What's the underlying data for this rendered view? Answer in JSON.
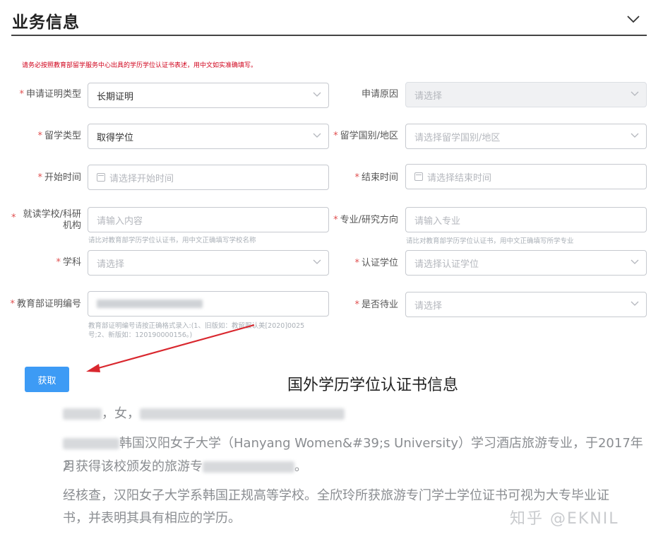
{
  "header": {
    "title": "业务信息"
  },
  "notice": "请务必按照教育部留学服务中心出具的学历学位认证书表述，用中文如实准确填写。",
  "fields": {
    "cert_type": {
      "label": "申请证明类型",
      "value": "长期证明"
    },
    "apply_reason": {
      "label": "申请原因",
      "placeholder": "请选择"
    },
    "study_type": {
      "label": "留学类型",
      "value": "取得学位"
    },
    "study_country": {
      "label": "留学国别/地区",
      "placeholder": "请选择留学国别/地区"
    },
    "start_time": {
      "label": "开始时间",
      "placeholder": "请选择开始时间"
    },
    "end_time": {
      "label": "结束时间",
      "placeholder": "请选择结束时间"
    },
    "school": {
      "label_line1": "就读学校/科研",
      "label_line2": "机构",
      "placeholder": "请输入内容",
      "hint": "请比对教育部学历学位认证书，用中文正确填写学校名称"
    },
    "major": {
      "label": "专业/研究方向",
      "placeholder": "请输入专业",
      "hint": "请比对教育部学历学位认证书，用中文正确填写所学专业"
    },
    "subject": {
      "label": "学科",
      "placeholder": "请选择"
    },
    "degree": {
      "label": "认证学位",
      "placeholder": "请选择认证学位"
    },
    "moe_number": {
      "label": "教育部证明编号",
      "hint_line1": "教育部证明编号请按正确格式录入:(1、旧版如：教留服认美[2020]0025",
      "hint_line2": "号;2、新版如：120190000156。)"
    },
    "waiting": {
      "label": "是否待业",
      "placeholder": "请选择"
    }
  },
  "fetch_button": {
    "label": "获取"
  },
  "certificate": {
    "title": "国外学历学位认证书信息",
    "line1_gender": "，女，",
    "line2_text": "韩国汉阳女子大学（Hanyang Women&#39;s University）学习酒店旅游专业，于2017年2",
    "line3_text": "月获得该校颁发的旅游专",
    "line3_end": "。",
    "line4_text": "经核查，汉阳女子大学系韩国正规高等学校。全欣玲所获旅游专门学士学位证书可视为大专毕业证",
    "line5_text": "书，并表明其具有相应的学历。"
  },
  "watermark": "知乎 @EKNIL",
  "colors": {
    "required_star": "#e04f4f",
    "notice_red": "#d0021b",
    "button_blue": "#3d9bf5",
    "arrow_red": "#d9272e"
  }
}
